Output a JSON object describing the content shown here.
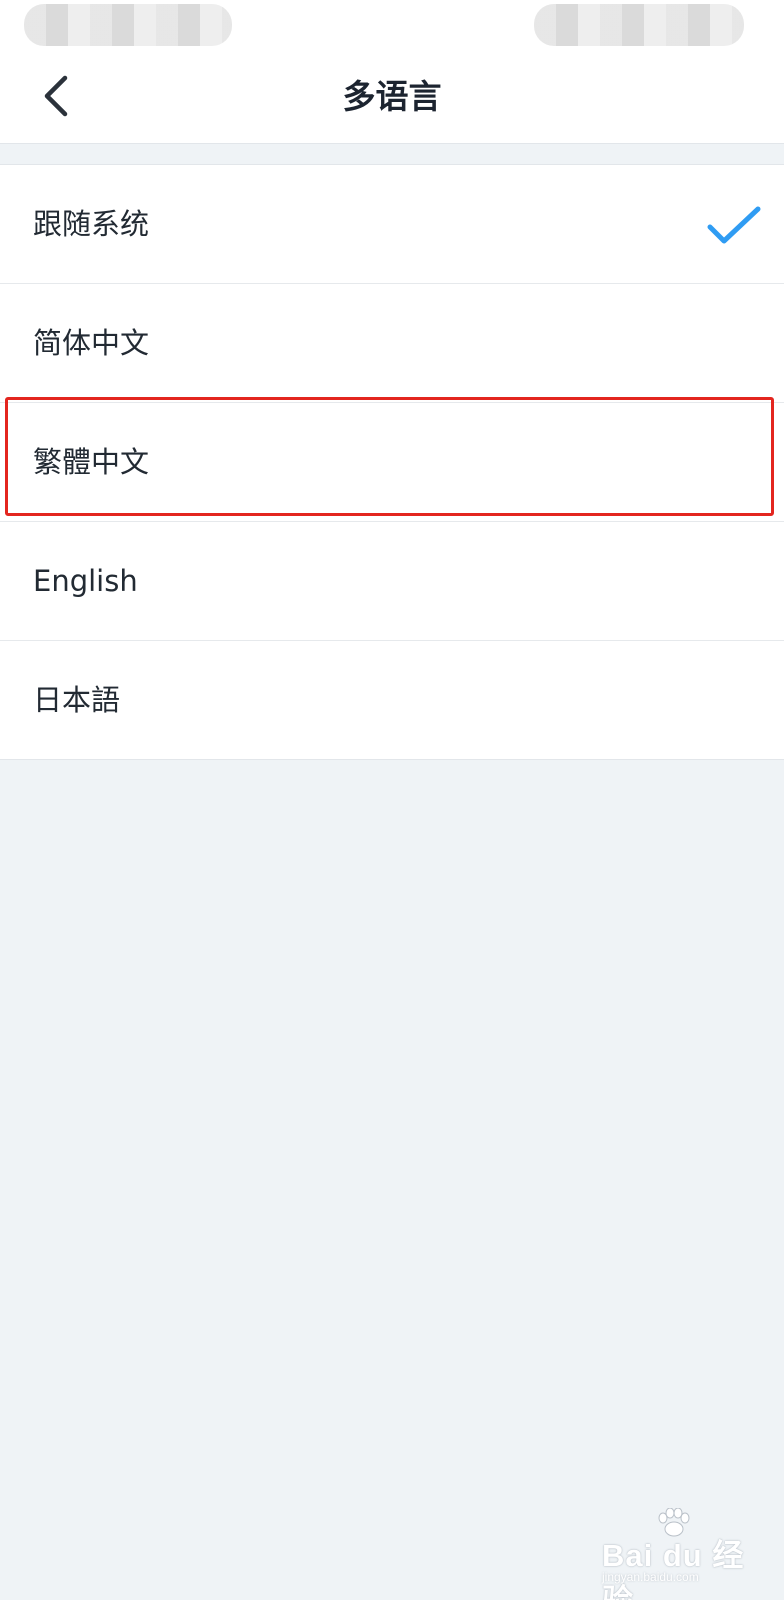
{
  "header": {
    "title": "多语言",
    "back_icon": "chevron-left-icon"
  },
  "languages": {
    "items": [
      {
        "label": "跟随系统",
        "selected": true
      },
      {
        "label": "简体中文",
        "selected": false
      },
      {
        "label": "繁體中文",
        "selected": false
      },
      {
        "label": "English",
        "selected": false
      },
      {
        "label": "日本語",
        "selected": false
      }
    ],
    "highlighted": "繁體中文"
  },
  "watermark": {
    "logo": "Bai du 经验",
    "url": "jingyan.baidu.com"
  },
  "colors": {
    "accent_check": "#2f9cf3",
    "highlight_border": "#e3261f",
    "background": "#eff3f6"
  }
}
